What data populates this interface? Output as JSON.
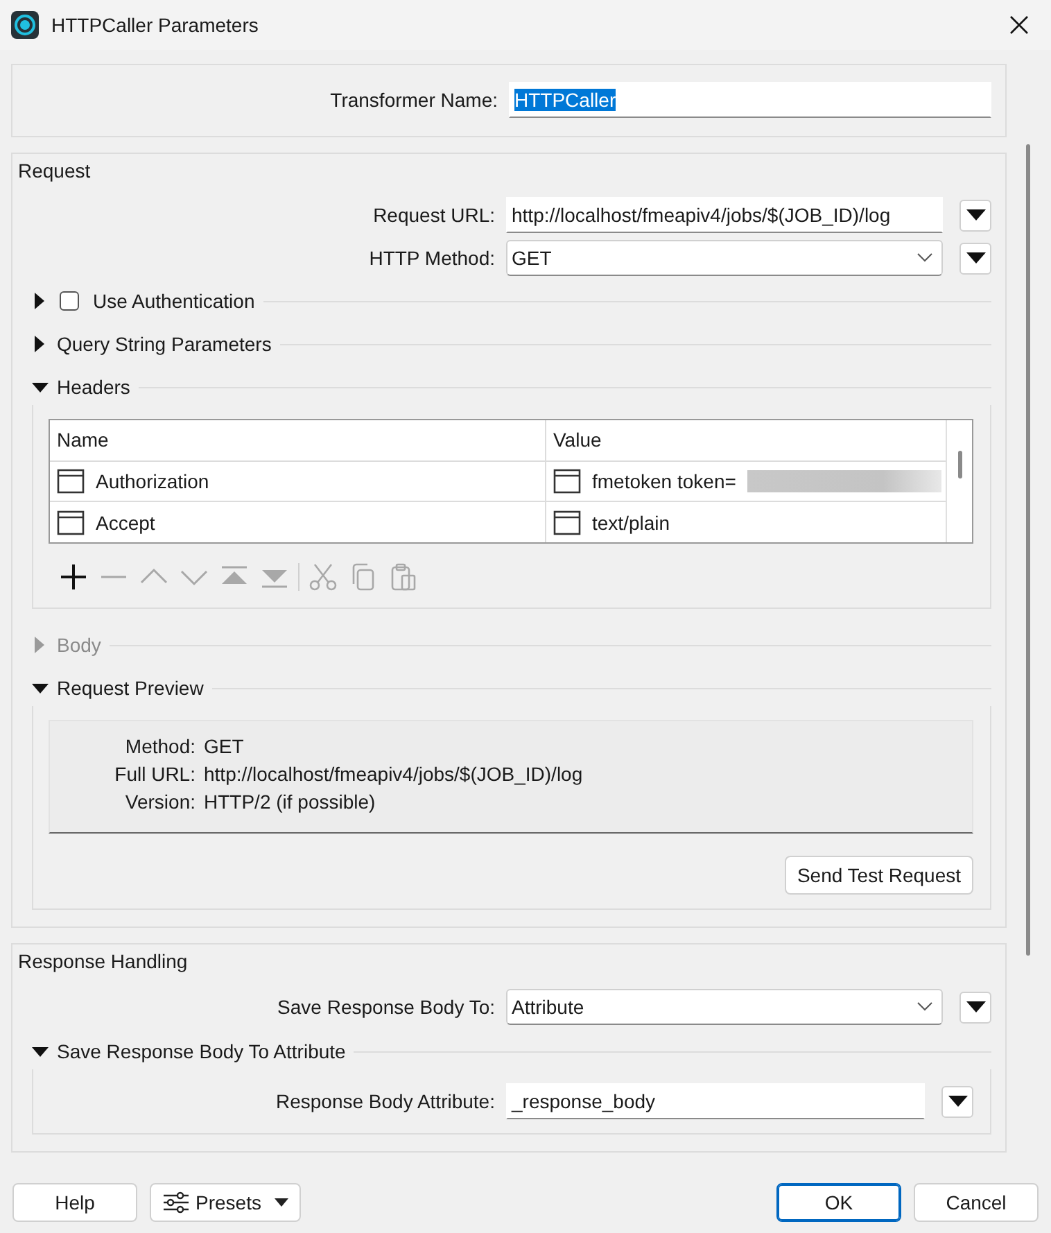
{
  "window": {
    "title": "HTTPCaller Parameters"
  },
  "transformer_name": {
    "label": "Transformer Name:",
    "value": "HTTPCaller",
    "value_selected": true
  },
  "request": {
    "title": "Request",
    "fields": [
      {
        "label": "Request URL:",
        "value": "http://localhost/fmeapiv4/jobs/$(JOB_ID)/log",
        "kind": "text"
      },
      {
        "label": "HTTP Method:",
        "value": "GET",
        "kind": "select"
      }
    ],
    "authentication": {
      "label": "Use Authentication",
      "expanded": false,
      "checked": false
    },
    "query_string": {
      "label": "Query String Parameters",
      "expanded": false
    },
    "headers": {
      "label": "Headers",
      "expanded": true,
      "columns": [
        "Name",
        "Value"
      ],
      "rows": [
        {
          "name": "Authorization",
          "value": "fmetoken token=",
          "redacted": true
        },
        {
          "name": "Accept",
          "value": "text/plain",
          "redacted": false
        }
      ],
      "tools": [
        {
          "kind": "add",
          "disabled": false
        },
        {
          "kind": "remove",
          "disabled": true
        },
        {
          "kind": "up",
          "disabled": true
        },
        {
          "kind": "down",
          "disabled": true
        },
        {
          "kind": "top",
          "disabled": true
        },
        {
          "kind": "bottom",
          "disabled": true
        },
        {
          "kind": "cut",
          "disabled": true
        },
        {
          "kind": "copy",
          "disabled": true
        },
        {
          "kind": "paste",
          "disabled": true
        }
      ]
    },
    "body": {
      "label": "Body",
      "expanded": false,
      "disabled": true
    },
    "preview": {
      "label": "Request Preview",
      "expanded": true,
      "lines": [
        {
          "label": "Method:",
          "value": "GET"
        },
        {
          "label": "Full URL:",
          "value": "http://localhost/fmeapiv4/jobs/$(JOB_ID)/log"
        },
        {
          "label": "Version:",
          "value": "HTTP/2 (if possible)"
        }
      ],
      "button": "Send Test Request"
    }
  },
  "response": {
    "title": "Response Handling",
    "fields": [
      {
        "label": "Save Response Body To:",
        "value": "Attribute",
        "kind": "select"
      }
    ],
    "section": {
      "label": "Save Response Body To Attribute",
      "expanded": true,
      "fields": [
        {
          "label": "Response Body Attribute:",
          "value": "_response_body",
          "kind": "text"
        }
      ]
    }
  },
  "footer": {
    "buttons": [
      {
        "label": "Help",
        "kind": "plain",
        "default": false
      },
      {
        "label": "Presets",
        "kind": "menu",
        "default": false
      },
      {
        "label": "OK",
        "kind": "plain",
        "default": true
      },
      {
        "label": "Cancel",
        "kind": "plain",
        "default": false
      }
    ]
  }
}
